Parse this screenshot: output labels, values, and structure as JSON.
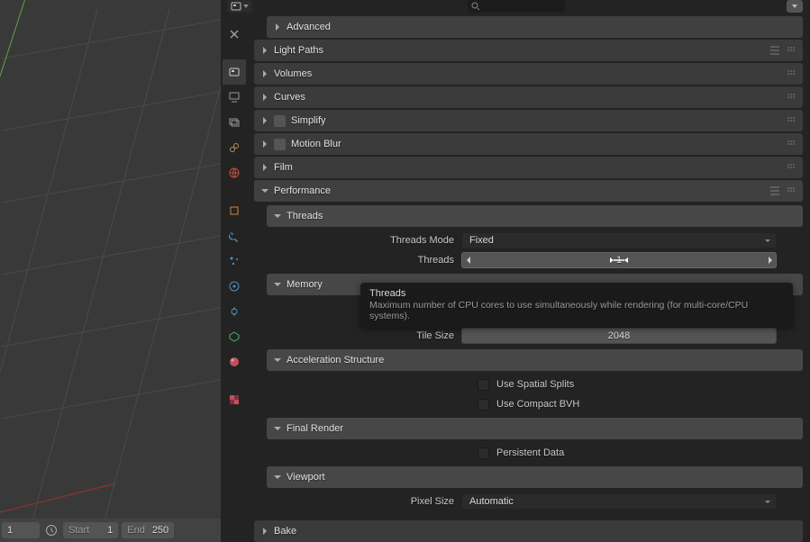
{
  "sections": {
    "advanced": "Advanced",
    "lightpaths": "Light Paths",
    "volumes": "Volumes",
    "curves": "Curves",
    "simplify": "Simplify",
    "motionblur": "Motion Blur",
    "film": "Film",
    "performance": "Performance",
    "threads": "Threads",
    "memory": "Memory",
    "accel": "Acceleration Structure",
    "finalrender": "Final Render",
    "viewport": "Viewport",
    "bake": "Bake"
  },
  "props": {
    "threads_mode_label": "Threads Mode",
    "threads_mode_value": "Fixed",
    "threads_label": "Threads",
    "threads_value": "1",
    "tile_size_label": "Tile Size",
    "tile_size_value": "2048",
    "spatial_splits": "Use Spatial Splits",
    "compact_bvh": "Use Compact BVH",
    "persistent": "Persistent Data",
    "pixel_size_label": "Pixel Size",
    "pixel_size_value": "Automatic"
  },
  "tooltip": {
    "title": "Threads",
    "desc": "Maximum number of CPU cores to use simultaneously while rendering (for multi-core/CPU systems)."
  },
  "timeline": {
    "current": "1",
    "start_label": "Start",
    "start_value": "1",
    "end_label": "End",
    "end_value": "250"
  }
}
